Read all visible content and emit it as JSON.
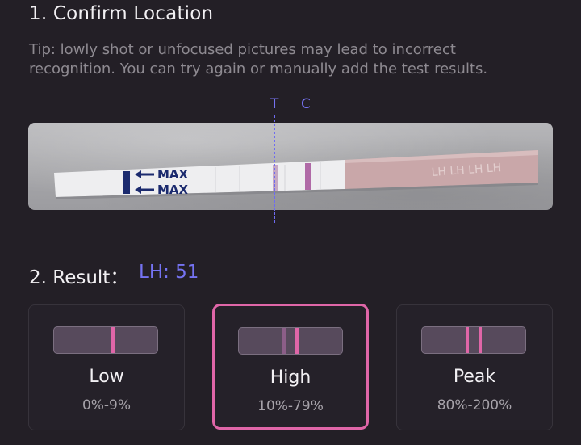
{
  "confirm": {
    "title": "1. Confirm Location",
    "tip_line1": "Tip: lowly shot or unfocused pictures may lead to incorrect",
    "tip_line2": "recognition. You can try again or manually add the test results."
  },
  "strip": {
    "markers": [
      "T",
      "C"
    ],
    "printed_text": [
      "MAX",
      "MAX"
    ],
    "marker_color": "#7572f0"
  },
  "result": {
    "label": "2. Result：",
    "value": "LH: 51"
  },
  "levels": [
    {
      "name": "Low",
      "range": "0%-9%",
      "selected": false
    },
    {
      "name": "High",
      "range": "10%-79%",
      "selected": true
    },
    {
      "name": "Peak",
      "range": "80%-200%",
      "selected": false
    }
  ],
  "colors": {
    "background": "#231f26",
    "accent": "#7573f2",
    "selected_border": "#e066a8",
    "band": "#e066a8"
  }
}
